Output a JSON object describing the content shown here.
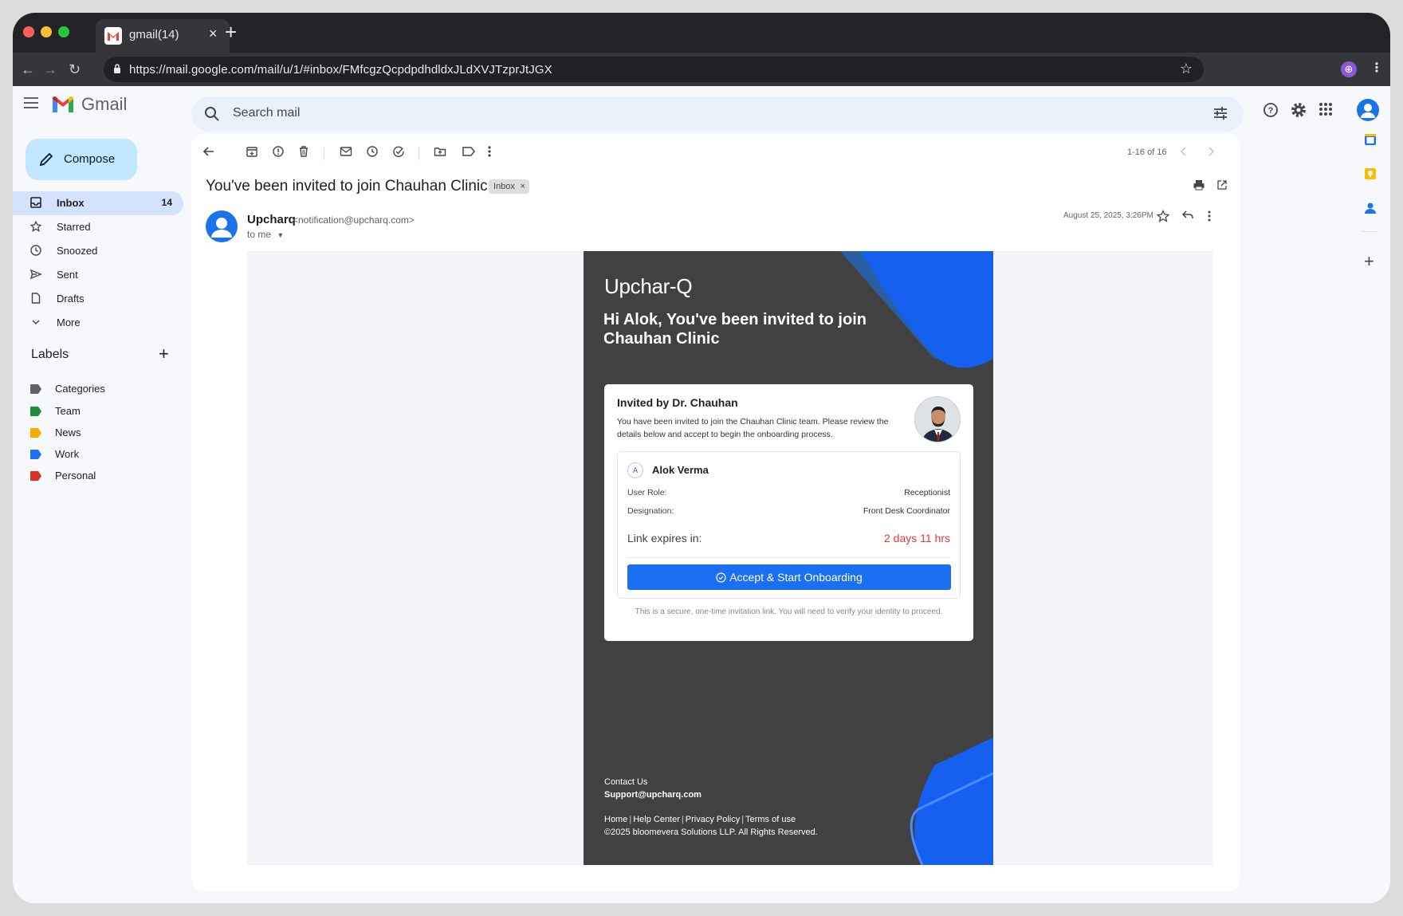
{
  "browser": {
    "tab_title": "gmail(14)",
    "url": "https://mail.google.com/mail/u/1/#inbox/FMfcgzQcpdpdhdldxJLdXVJTzprJtJGX"
  },
  "gmail": {
    "logo_text": "Gmail",
    "search_placeholder": "Search mail",
    "compose_label": "Compose",
    "nav": [
      {
        "label": "Inbox",
        "count": "14",
        "icon": "inbox-icon"
      },
      {
        "label": "Starred",
        "count": "",
        "icon": "star-icon"
      },
      {
        "label": "Snoozed",
        "count": "",
        "icon": "clock-icon"
      },
      {
        "label": "Sent",
        "count": "",
        "icon": "send-icon"
      },
      {
        "label": "Drafts",
        "count": "",
        "icon": "draft-icon"
      },
      {
        "label": "More",
        "count": "",
        "icon": "chevron-down-icon"
      }
    ],
    "labels_header": "Labels",
    "labels": [
      {
        "label": "Categories",
        "color": "#5f6368"
      },
      {
        "label": "Team",
        "color": "#1e8e3e"
      },
      {
        "label": "News",
        "color": "#f9ab00"
      },
      {
        "label": "Work",
        "color": "#1a73e8"
      },
      {
        "label": "Personal",
        "color": "#d93025"
      }
    ]
  },
  "message": {
    "pager": "1-16 of 16",
    "subject": "You've been invited to join Chauhan Clinic",
    "inbox_chip": "Inbox",
    "sender_name": "Upcharq",
    "sender_email": "<notification@upcharq.com>",
    "to": "to me",
    "date": "August 25, 2025, 3:26PM"
  },
  "email": {
    "brand": "Upchar-Q",
    "headline": "Hi Alok, You've been invited to join Chauhan Clinic",
    "invited_by": "Invited by Dr. Chauhan",
    "description": "You have been invited to join the Chauhan Clinic team. Please review the details below and accept to begin the onboarding process.",
    "avatar_initial": "A",
    "invitee_name": "Alok Verma",
    "role_label": "User Role:",
    "role_value": "Receptionist",
    "designation_label": "Designation:",
    "designation_value": "Front Desk Coordinator",
    "expires_label": "Link expires in:",
    "expires_value": "2 days 11 hrs",
    "accept_button": "Accept & Start Onboarding",
    "secure_note": "This is a secure, one-time invitation link. You will need to verify your identity to proceed.",
    "contact_label": "Contact Us",
    "support_email": "Support@upcharq.com",
    "footer_links": [
      "Home",
      "Help Center",
      "Privacy Policy",
      "Terms of use"
    ],
    "copyright": "©2025 bloomevera Solutions LLP. All Rights Reserved."
  },
  "colors": {
    "accent": "#1a73e8",
    "email_bg": "#414141",
    "expiry": "#e53935",
    "accept_button": "#1a6ff2"
  }
}
